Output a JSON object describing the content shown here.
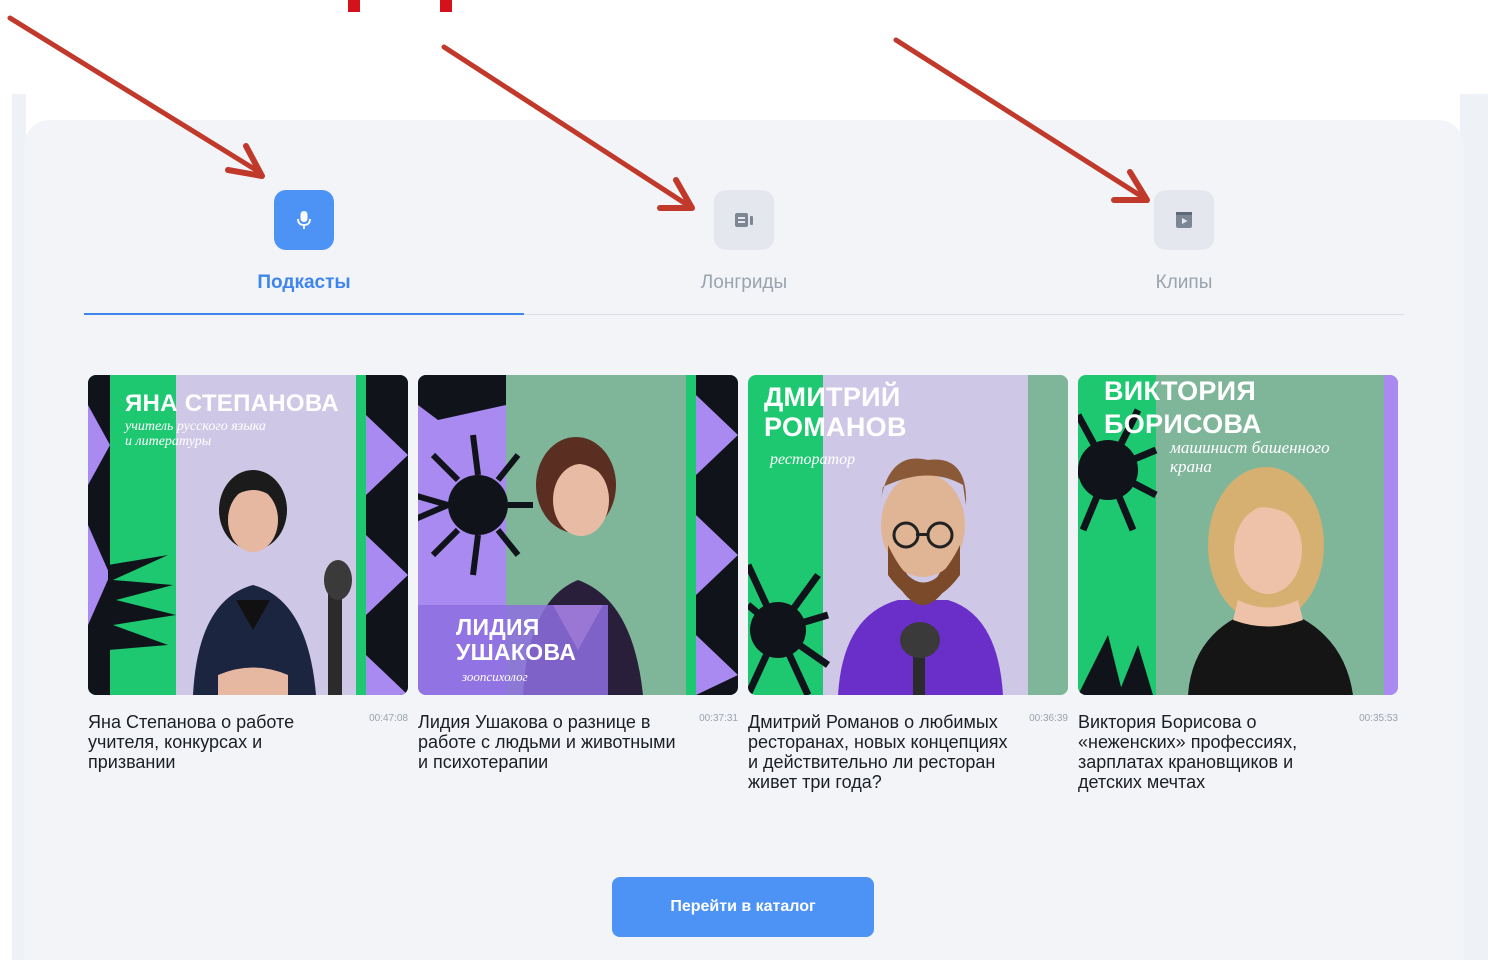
{
  "tabs": [
    {
      "label": "Подкасты",
      "icon": "microphone-icon",
      "active": true
    },
    {
      "label": "Лонгриды",
      "icon": "longread-icon",
      "active": false
    },
    {
      "label": "Клипы",
      "icon": "clip-icon",
      "active": false
    }
  ],
  "cards": [
    {
      "cover_name": "ЯНА СТЕПАНОВА",
      "cover_role": "учитель русского языка и литературы",
      "title": "Яна Степанова о работе учителя, конкурсах и призвании",
      "duration": "00:47:08"
    },
    {
      "cover_name": "ЛИДИЯ УШАКОВА",
      "cover_role": "зоопсихолог",
      "title": "Лидия Ушакова о разнице в работе с людьми и животными и психотерапии",
      "duration": "00:37:31"
    },
    {
      "cover_name": "ДМИТРИЙ РОМАНОВ",
      "cover_role": "ресторатор",
      "title": "Дмитрий Романов о любимых ресторанах, новых концепциях и действительно ли ресторан живет три года?",
      "duration": "00:36:39"
    },
    {
      "cover_name": "ВИКТОРИЯ БОРИСОВА",
      "cover_role": "машинист башенного крана",
      "title": "Виктория Борисова о «неженских» профессиях, зарплатах крановщиков и детских мечтах",
      "duration": "00:35:53"
    }
  ],
  "catalog_button": "Перейти в каталог",
  "colors": {
    "accent": "#4c93f5",
    "annotation_red": "#c0392b",
    "cover_green": "#1ec871",
    "cover_purple": "#a98af0",
    "cover_sage": "#7fb69a"
  }
}
